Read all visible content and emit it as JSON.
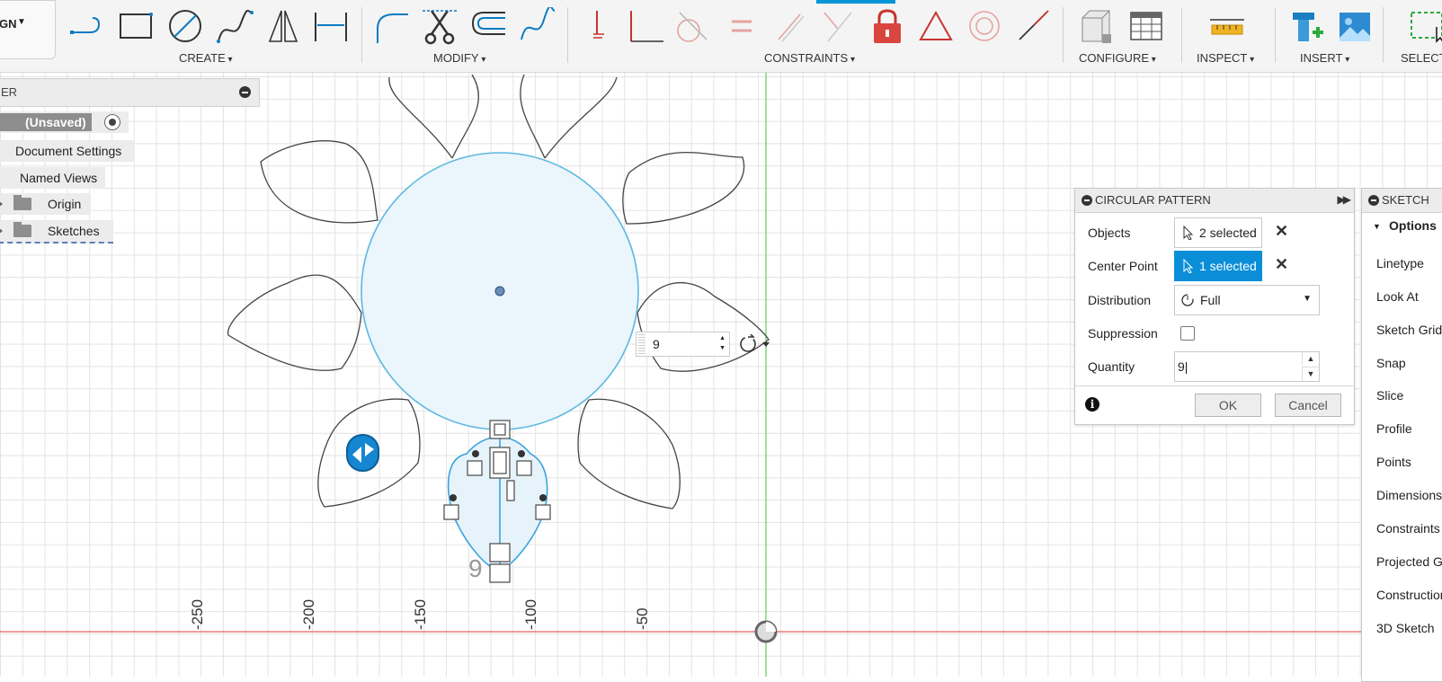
{
  "toolbar": {
    "workspace": "GN",
    "groups": {
      "create": "CREATE",
      "modify": "MODIFY",
      "constraints": "CONSTRAINTS",
      "configure": "CONFIGURE",
      "inspect": "INSPECT",
      "insert": "INSERT",
      "select": "SELECT"
    }
  },
  "browser": {
    "title": "ER",
    "document": "(Unsaved)",
    "items": [
      "Document Settings",
      "Named Views",
      "Origin",
      "Sketches"
    ]
  },
  "canvas": {
    "axis_labels": [
      "-250",
      "-200",
      "-150",
      "-100",
      "-50"
    ],
    "quantity_value": "9",
    "preview_number": "9"
  },
  "circular_pattern": {
    "title": "CIRCULAR PATTERN",
    "objects_label": "Objects",
    "objects_value": "2 selected",
    "center_label": "Center Point",
    "center_value": "1 selected",
    "distribution_label": "Distribution",
    "distribution_value": "Full",
    "suppression_label": "Suppression",
    "suppression_checked": false,
    "quantity_label": "Quantity",
    "quantity_value": "9|",
    "ok": "OK",
    "cancel": "Cancel",
    "accent_color": "#0b8ed8"
  },
  "sketch_palette": {
    "title": "SKETCH",
    "section": "Options",
    "items": [
      "Linetype",
      "Look At",
      "Sketch Grid",
      "Snap",
      "Slice",
      "Profile",
      "Points",
      "Dimensions",
      "Constraints",
      "Projected Ge",
      "Construction",
      "3D Sketch"
    ]
  }
}
